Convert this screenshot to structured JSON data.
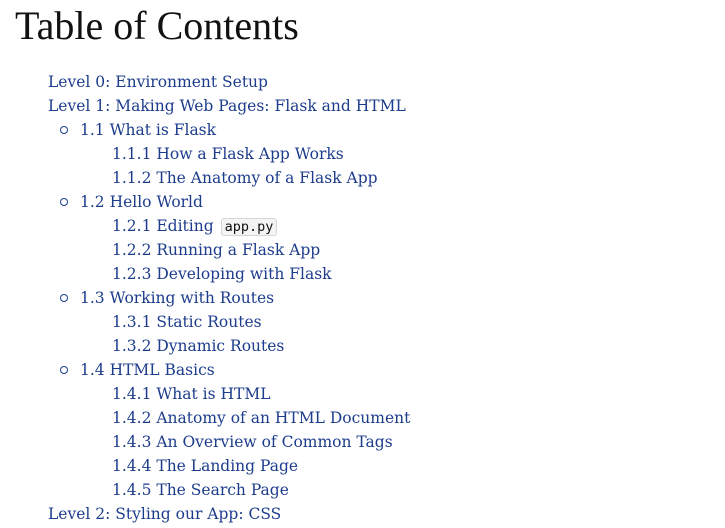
{
  "page_title": "Table of Contents",
  "toc": {
    "level0": "Level 0: Environment Setup",
    "level1": {
      "label": "Level 1: Making Web Pages: Flask and HTML",
      "s1_1": {
        "label": "1.1 What is Flask",
        "items": [
          "1.1.1 How a Flask App Works",
          "1.1.2 The Anatomy of a Flask App"
        ]
      },
      "s1_2": {
        "label": "1.2 Hello World",
        "editing_prefix": "1.2.1 Editing",
        "editing_code": "app.py",
        "items": [
          "1.2.2 Running a Flask App",
          "1.2.3 Developing with Flask"
        ]
      },
      "s1_3": {
        "label": "1.3 Working with Routes",
        "items": [
          "1.3.1 Static Routes",
          "1.3.2 Dynamic Routes"
        ]
      },
      "s1_4": {
        "label": "1.4 HTML Basics",
        "items": [
          "1.4.1 What is HTML",
          "1.4.2 Anatomy of an HTML Document",
          "1.4.3 An Overview of Common Tags",
          "1.4.4 The Landing Page",
          "1.4.5 The Search Page"
        ]
      }
    },
    "level2": "Level 2: Styling our App: CSS"
  },
  "colors": {
    "link": "#1c3c8c",
    "heading": "#111111"
  }
}
